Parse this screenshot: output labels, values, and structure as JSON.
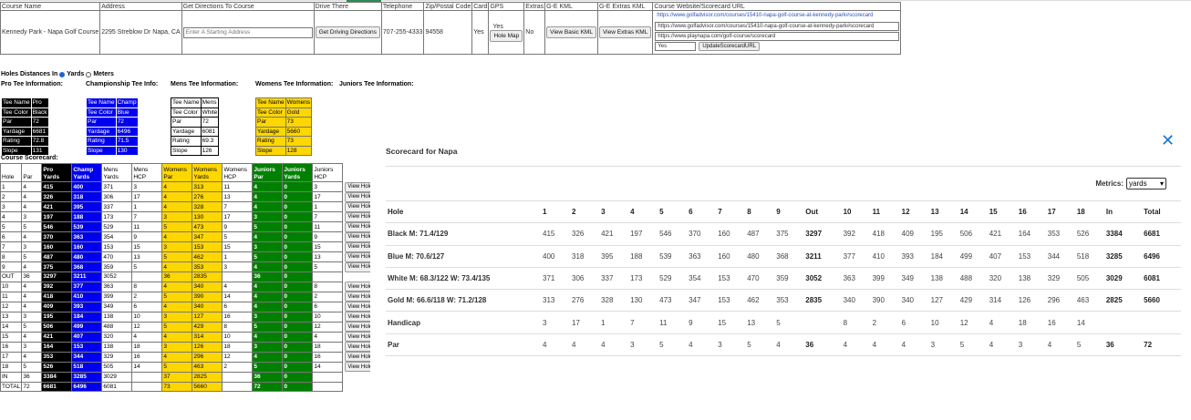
{
  "info": {
    "headers": [
      "Course Name",
      "Address",
      "Get Directions To Course",
      "Drive There",
      "Telephone",
      "Zip/Postal Code",
      "Card",
      "GPS",
      "Extras",
      "G-E KML",
      "G-E Extras KML",
      "Course Website/Scorecard URL"
    ],
    "course_name": "Kennedy Park - Napa Golf Course",
    "address": "2295 Streblow Dr Napa, CA",
    "start_placeholder": "Enter A Starting Address",
    "driving_btn": "Get Driving Directions",
    "telephone": "707-255-4333",
    "zip": "94558",
    "card": "Yes",
    "gps": "Yes",
    "hole_map_btn": "Hole Map",
    "extras": "No",
    "basic_kml_btn": "View Basic KML",
    "extras_kml_btn": "View Extras KML",
    "urls": [
      "https://www.golfadvisor.com/courses/15410-napa-golf-course-at-kennedy-park#scorecard",
      "https://www.golfadvisor.com/courses/15410-napa-golf-course-at-kennedy-park#scorecard",
      "https://www.playnapa.com/golf-course/scorecard"
    ],
    "yes_field": "Yes",
    "update_btn": "UpdateScorecardURL"
  },
  "units": {
    "label": "Holes Distances In",
    "yards": "Yards",
    "meters": "Meters"
  },
  "tee_headers": [
    "Pro Tee Information:",
    "Championship Tee Info:",
    "Mens Tee Information:",
    "Womens Tee Information:",
    "Juniors Tee Information:"
  ],
  "tees": {
    "labels": [
      "Tee Name",
      "Tee Color",
      "Par",
      "Yardage",
      "Rating",
      "Slope"
    ],
    "pro": [
      "Pro",
      "Black",
      "72",
      "6681",
      "72.8",
      "131"
    ],
    "champ": [
      "Champ",
      "Blue",
      "72",
      "6496",
      "71.5",
      "130"
    ],
    "mens": [
      "Mens",
      "White",
      "72",
      "6081",
      "69.3",
      "126"
    ],
    "womens": [
      "Womens",
      "Gold",
      "73",
      "5660",
      "73",
      "128"
    ]
  },
  "course_scorecard_title": "Course Scorecard:",
  "sc": {
    "headers": [
      "Hole",
      "Par",
      "Pro Yards",
      "Champ Yards",
      "Mens Yards",
      "Mens HCP",
      "Womens Par",
      "Womens Yards",
      "Womens HCP",
      "Juniors Par",
      "Juniors Yards",
      "Juniors HCP"
    ],
    "view_label": "View Hole",
    "rows": [
      [
        "1",
        "4",
        "415",
        "400",
        "371",
        "3",
        "4",
        "313",
        "11",
        "4",
        "0",
        "3"
      ],
      [
        "2",
        "4",
        "326",
        "318",
        "306",
        "17",
        "4",
        "276",
        "13",
        "4",
        "0",
        "17"
      ],
      [
        "3",
        "4",
        "421",
        "395",
        "337",
        "1",
        "4",
        "328",
        "7",
        "4",
        "0",
        "1"
      ],
      [
        "4",
        "3",
        "197",
        "188",
        "173",
        "7",
        "3",
        "130",
        "17",
        "3",
        "0",
        "7"
      ],
      [
        "5",
        "5",
        "546",
        "539",
        "529",
        "11",
        "5",
        "473",
        "9",
        "5",
        "0",
        "11"
      ],
      [
        "6",
        "4",
        "370",
        "363",
        "354",
        "9",
        "4",
        "347",
        "5",
        "4",
        "0",
        "9"
      ],
      [
        "7",
        "3",
        "160",
        "160",
        "153",
        "15",
        "3",
        "153",
        "15",
        "3",
        "0",
        "15"
      ],
      [
        "8",
        "5",
        "487",
        "480",
        "470",
        "13",
        "5",
        "462",
        "1",
        "5",
        "0",
        "13"
      ],
      [
        "9",
        "4",
        "375",
        "368",
        "359",
        "5",
        "4",
        "353",
        "3",
        "4",
        "0",
        "5"
      ],
      [
        "OUT",
        "36",
        "3297",
        "3211",
        "3052",
        "",
        "36",
        "2835",
        "",
        "36",
        "0",
        ""
      ],
      [
        "10",
        "4",
        "392",
        "377",
        "363",
        "8",
        "4",
        "340",
        "4",
        "4",
        "0",
        "8"
      ],
      [
        "11",
        "4",
        "418",
        "410",
        "399",
        "2",
        "5",
        "390",
        "14",
        "4",
        "0",
        "2"
      ],
      [
        "12",
        "4",
        "409",
        "393",
        "349",
        "6",
        "4",
        "340",
        "6",
        "4",
        "0",
        "6"
      ],
      [
        "13",
        "3",
        "195",
        "184",
        "138",
        "10",
        "3",
        "127",
        "16",
        "3",
        "0",
        "10"
      ],
      [
        "14",
        "5",
        "506",
        "499",
        "488",
        "12",
        "5",
        "429",
        "8",
        "5",
        "0",
        "12"
      ],
      [
        "15",
        "4",
        "421",
        "407",
        "320",
        "4",
        "4",
        "314",
        "10",
        "4",
        "0",
        "4"
      ],
      [
        "16",
        "3",
        "164",
        "153",
        "138",
        "18",
        "3",
        "126",
        "18",
        "3",
        "0",
        "18"
      ],
      [
        "17",
        "4",
        "353",
        "344",
        "329",
        "16",
        "4",
        "296",
        "12",
        "4",
        "0",
        "16"
      ],
      [
        "18",
        "5",
        "526",
        "518",
        "505",
        "14",
        "5",
        "463",
        "2",
        "5",
        "0",
        "14"
      ],
      [
        "IN",
        "36",
        "3384",
        "3285",
        "3029",
        "",
        "37",
        "2825",
        "",
        "36",
        "0",
        ""
      ],
      [
        "TOTAL",
        "72",
        "6681",
        "6496",
        "6081",
        "",
        "73",
        "5660",
        "",
        "72",
        "0",
        ""
      ]
    ]
  },
  "modal": {
    "title": "Scorecard for Napa",
    "metrics_label": "Metrics:",
    "metrics_value": "yards",
    "headers": [
      "Hole",
      "1",
      "2",
      "3",
      "4",
      "5",
      "6",
      "7",
      "8",
      "9",
      "Out",
      "10",
      "11",
      "12",
      "13",
      "14",
      "15",
      "16",
      "17",
      "18",
      "In",
      "Total"
    ],
    "rows": [
      [
        "Black M: 71.4/129",
        "415",
        "326",
        "421",
        "197",
        "546",
        "370",
        "160",
        "487",
        "375",
        "3297",
        "392",
        "418",
        "409",
        "195",
        "506",
        "421",
        "164",
        "353",
        "526",
        "3384",
        "6681"
      ],
      [
        "Blue M: 70.6/127",
        "400",
        "318",
        "395",
        "188",
        "539",
        "363",
        "160",
        "480",
        "368",
        "3211",
        "377",
        "410",
        "393",
        "184",
        "499",
        "407",
        "153",
        "344",
        "518",
        "3285",
        "6496"
      ],
      [
        "White M: 68.3/122 W: 73.4/135",
        "371",
        "306",
        "337",
        "173",
        "529",
        "354",
        "153",
        "470",
        "359",
        "3052",
        "363",
        "399",
        "349",
        "138",
        "488",
        "320",
        "138",
        "329",
        "505",
        "3029",
        "6081"
      ],
      [
        "Gold M: 66.6/118 W: 71.2/128",
        "313",
        "276",
        "328",
        "130",
        "473",
        "347",
        "153",
        "462",
        "353",
        "2835",
        "340",
        "390",
        "340",
        "127",
        "429",
        "314",
        "126",
        "296",
        "463",
        "2825",
        "5660"
      ],
      [
        "Handicap",
        "3",
        "17",
        "1",
        "7",
        "11",
        "9",
        "15",
        "13",
        "5",
        "",
        "8",
        "2",
        "6",
        "10",
        "12",
        "4",
        "18",
        "16",
        "14",
        "",
        ""
      ],
      [
        "Par",
        "4",
        "4",
        "4",
        "3",
        "5",
        "4",
        "3",
        "5",
        "4",
        "36",
        "4",
        "4",
        "4",
        "3",
        "5",
        "4",
        "3",
        "4",
        "5",
        "36",
        "72"
      ]
    ]
  }
}
